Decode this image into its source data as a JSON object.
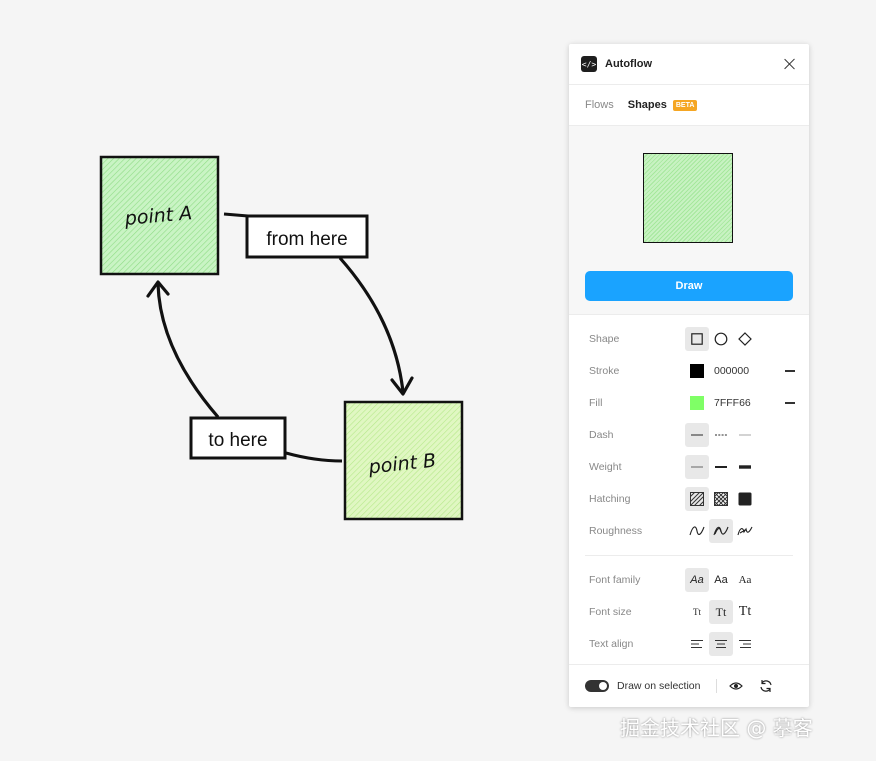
{
  "canvas": {
    "node_a_label": "point A",
    "node_b_label": "point B",
    "edge_1_label": "from here",
    "edge_2_label": "to here"
  },
  "panel": {
    "title": "Autoflow",
    "tabs": [
      {
        "label": "Flows",
        "active": false
      },
      {
        "label": "Shapes",
        "active": true,
        "badge": "BETA"
      }
    ],
    "draw_button": "Draw",
    "properties": {
      "shape": {
        "label": "Shape",
        "options": [
          "rectangle-icon",
          "circle-icon",
          "diamond-icon"
        ],
        "selected": 0
      },
      "stroke": {
        "label": "Stroke",
        "hex": "000000",
        "color": "#000000"
      },
      "fill": {
        "label": "Fill",
        "hex": "7FFF66",
        "color": "#7FFF66"
      },
      "dash": {
        "label": "Dash",
        "options": [
          "solid-line-icon",
          "dashed-line-icon",
          "dotted-line-icon"
        ],
        "selected": 0
      },
      "weight": {
        "label": "Weight",
        "options": [
          "thin-line-icon",
          "medium-line-icon",
          "thick-line-icon"
        ],
        "selected": 0
      },
      "hatching": {
        "label": "Hatching",
        "options": [
          "hatch-lines-icon",
          "cross-hatch-icon",
          "solid-fill-icon"
        ],
        "selected": 0
      },
      "roughness": {
        "label": "Roughness",
        "options": [
          "rough-low-icon",
          "rough-medium-icon",
          "rough-high-icon"
        ],
        "selected": 1
      },
      "font_family": {
        "label": "Font family",
        "options": [
          "Aa",
          "Aa",
          "Aa"
        ],
        "selected": 0
      },
      "font_size": {
        "label": "Font size",
        "options": [
          "Tt",
          "Tt",
          "Tt"
        ],
        "selected": 1
      },
      "text_align": {
        "label": "Text align",
        "options": [
          "align-left-icon",
          "align-center-icon",
          "align-right-icon"
        ],
        "selected": 1
      }
    },
    "footer": {
      "toggle_label": "Draw on selection",
      "toggle_on": true
    }
  },
  "watermark": "掘金技术社区 @ 摹客"
}
